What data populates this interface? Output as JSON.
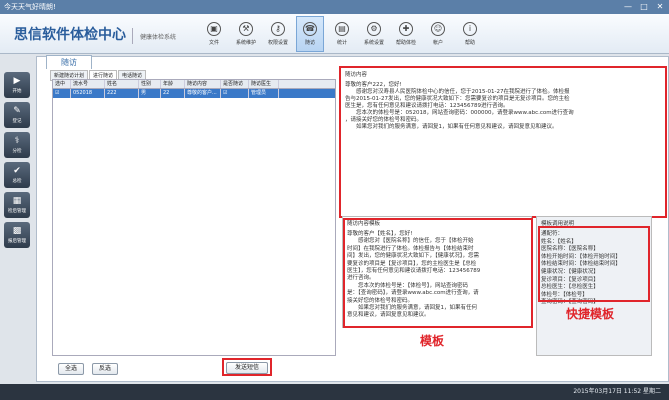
{
  "window": {
    "title": "今天天气好晴朗!",
    "minimize": "—",
    "maximize": "□",
    "close": "✕"
  },
  "header": {
    "logo": "思信软件体检中心",
    "subtitle": "健康体检系统",
    "tools": [
      {
        "label": "文件",
        "icon": "file-icon",
        "glyph": "▣"
      },
      {
        "label": "系统维护",
        "icon": "maintenance-icon",
        "glyph": "⚒"
      },
      {
        "label": "权限设置",
        "icon": "permission-icon",
        "glyph": "⚷"
      },
      {
        "label": "随访",
        "icon": "followup-icon",
        "glyph": "☎"
      },
      {
        "label": "统计",
        "icon": "statistics-icon",
        "glyph": "▤"
      },
      {
        "label": "系统设置",
        "icon": "settings-icon",
        "glyph": "⚙"
      },
      {
        "label": "帮助体检",
        "icon": "checkup-icon",
        "glyph": "✚"
      },
      {
        "label": "帐户",
        "icon": "account-icon",
        "glyph": "☺"
      },
      {
        "label": "帮助",
        "icon": "help-icon",
        "glyph": "i"
      }
    ]
  },
  "sidebar": [
    {
      "label": "开始",
      "glyph": "▶"
    },
    {
      "label": "登记",
      "glyph": "✎"
    },
    {
      "label": "分检",
      "glyph": "⚕"
    },
    {
      "label": "总检",
      "glyph": "✔"
    },
    {
      "label": "检后管理",
      "glyph": "▦"
    },
    {
      "label": "报后管理",
      "glyph": "▩"
    }
  ],
  "page": {
    "tab": "随访",
    "inner_tabs": [
      "新建随访计划",
      "进行随访",
      "电话随访"
    ],
    "grid": {
      "headers": [
        "选中",
        "流水号",
        "姓名",
        "性别",
        "年龄",
        "随访内容",
        "是否随访",
        "随访医生"
      ],
      "rows": [
        [
          "☑",
          "052018",
          "222",
          "男",
          "22",
          "尊敬的客户...",
          "☑",
          "管理员"
        ]
      ]
    },
    "content_panel": {
      "title": "随访内容",
      "lines": [
        "尊敬的客户222，您好!",
        "　　感谢您对汉寿县人民医院体检中心的信任，您于2015-01-27在我院进行了体检。体检报",
        "告与2015-01-27发出，您的健康状况大致如下：您需要复诊的项目是无复诊项目。您的主检",
        "医生是，您有任何意见和建议请拨打电话：123456789进行咨询。",
        "　　您本次的体检号是：052018，网站查询密码：000000，请登录www.abc.com进行查询",
        "，请接关好您的体检号和密码。",
        "　　如果您对我们的服务满意，请回复1，如果有任何意见和建议，请回复意见和建议。"
      ]
    },
    "template_panel": {
      "title": "随访内容模板",
      "lines": [
        "尊敬的客户【姓名】，您好!",
        "　　感谢您对【医院名称】的信任，您于【体检开始",
        "时间】在我院进行了体检。体检报告与【体检结束时",
        "间】发出，您的健康状况大致如下，【健康状况】，您需",
        "要复诊的项目是【复诊项目】，您的主检医生是【总检",
        "医生】，您有任何意见和建议请拨打电话：123456789",
        "进行咨询。",
        "　　您本次的体检号是：【体检号】，网站查询密码",
        "是：【查询密码】，请登录www.abc.com进行查询，请",
        "接关好您的体检号和密码。",
        "　　如果您对我们的服务满意，请回复1，如果有任何",
        "意见和建议，请回复意见和建议。"
      ]
    },
    "help_panel": {
      "title": "模板调用说明",
      "lines": [
        "通配符：",
        "姓名：【姓名】",
        "医院名称：【医院名称】",
        "体检开始时间：【体检开始时间】",
        "体检结束时间：【体检结束时间】",
        "健康状况：【健康状况】",
        "复诊项目：【复诊项目】",
        "总检医生：【总检医生】",
        "体检号：【体检号】",
        "查询密码：【查询密码】"
      ]
    },
    "annotations": {
      "template": "模板",
      "shortcut": "快捷模板"
    },
    "buttons": {
      "select_all": "全选",
      "invert": "反选",
      "send": "发送短信"
    }
  },
  "statusbar": {
    "datetime": "2015年03月17日 11:52 星期二"
  }
}
